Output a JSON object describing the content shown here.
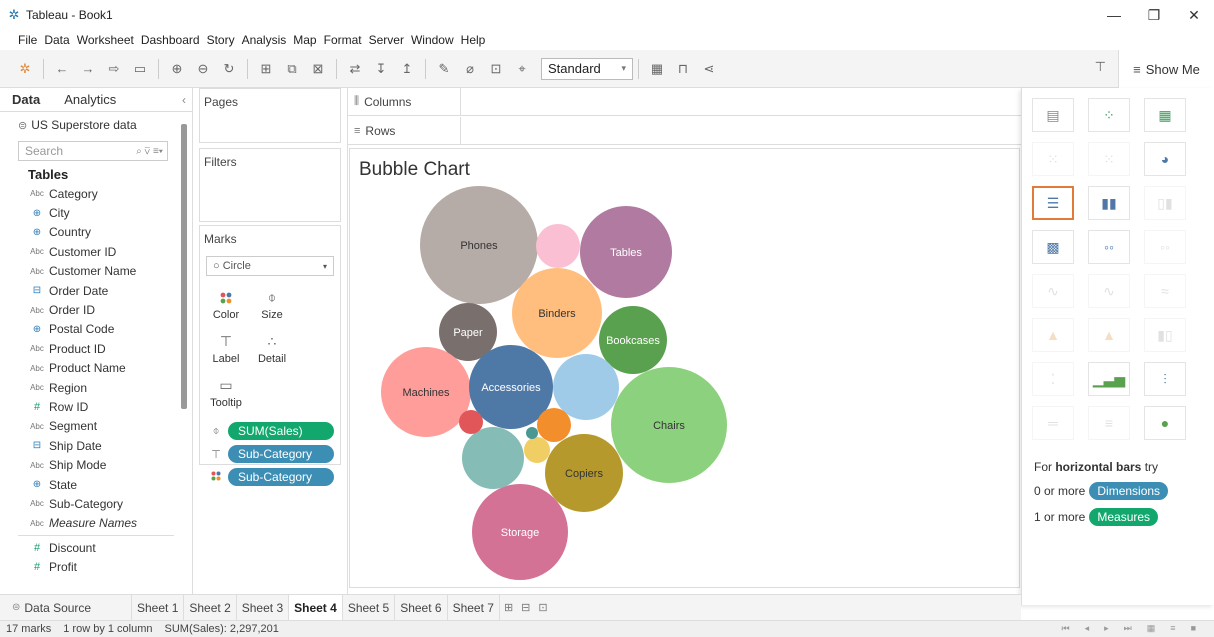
{
  "window": {
    "title": "Tableau - Book1"
  },
  "menu": [
    "File",
    "Data",
    "Worksheet",
    "Dashboard",
    "Story",
    "Analysis",
    "Map",
    "Format",
    "Server",
    "Window",
    "Help"
  ],
  "toolbar": {
    "fit_select": "Standard",
    "show_me": "Show Me"
  },
  "data_pane": {
    "tabs": [
      "Data",
      "Analytics"
    ],
    "datasource": "US Superstore data",
    "search_placeholder": "Search",
    "tables_header": "Tables",
    "fields": [
      {
        "name": "Category",
        "type": "Abc"
      },
      {
        "name": "City",
        "type": "geo"
      },
      {
        "name": "Country",
        "type": "geo"
      },
      {
        "name": "Customer ID",
        "type": "Abc"
      },
      {
        "name": "Customer Name",
        "type": "Abc"
      },
      {
        "name": "Order Date",
        "type": "date"
      },
      {
        "name": "Order ID",
        "type": "Abc"
      },
      {
        "name": "Postal Code",
        "type": "geo"
      },
      {
        "name": "Product ID",
        "type": "Abc"
      },
      {
        "name": "Product Name",
        "type": "Abc"
      },
      {
        "name": "Region",
        "type": "Abc"
      },
      {
        "name": "Row ID",
        "type": "num"
      },
      {
        "name": "Segment",
        "type": "Abc"
      },
      {
        "name": "Ship Date",
        "type": "date"
      },
      {
        "name": "Ship Mode",
        "type": "Abc"
      },
      {
        "name": "State",
        "type": "geo"
      },
      {
        "name": "Sub-Category",
        "type": "Abc"
      },
      {
        "name": "Measure Names",
        "type": "Abc"
      }
    ],
    "measures": [
      {
        "name": "Discount",
        "type": "num"
      },
      {
        "name": "Profit",
        "type": "num"
      }
    ]
  },
  "cards": {
    "pages": "Pages",
    "filters": "Filters",
    "marks": "Marks",
    "mark_type": "Circle",
    "mark_buttons": [
      "Color",
      "Size",
      "Label",
      "Detail",
      "Tooltip"
    ],
    "pills": [
      {
        "icon": "size",
        "label": "SUM(Sales)",
        "kind": "measure"
      },
      {
        "icon": "label",
        "label": "Sub-Category",
        "kind": "dim"
      },
      {
        "icon": "color",
        "label": "Sub-Category",
        "kind": "dim"
      }
    ]
  },
  "shelves": {
    "columns": "Columns",
    "rows": "Rows"
  },
  "viz": {
    "title": "Bubble Chart"
  },
  "chart_data": {
    "type": "bubble",
    "title": "Bubble Chart",
    "size_measure": "SUM(Sales)",
    "label_dimension": "Sub-Category",
    "bubbles": [
      {
        "label": "Phones",
        "color": "#b5aba7",
        "show_label": true,
        "text_color": "#333333"
      },
      {
        "label": "Tables",
        "color": "#b07aa1",
        "show_label": true,
        "text_color": "#ffffff"
      },
      {
        "label": "Binders",
        "color": "#ffbe7d",
        "show_label": true,
        "text_color": "#333333"
      },
      {
        "label": "Bookcases",
        "color": "#59a14f",
        "show_label": true,
        "text_color": "#ffffff"
      },
      {
        "label": "Paper",
        "color": "#79706e",
        "show_label": true,
        "text_color": "#ffffff"
      },
      {
        "label": "Machines",
        "color": "#ff9d9a",
        "show_label": true,
        "text_color": "#333333"
      },
      {
        "label": "Accessories",
        "color": "#4e79a7",
        "show_label": true,
        "text_color": "#ffffff"
      },
      {
        "label": "Chairs",
        "color": "#8cd17d",
        "show_label": true,
        "text_color": "#333333"
      },
      {
        "label": "Copiers",
        "color": "#b6992d",
        "show_label": true,
        "text_color": "#333333"
      },
      {
        "label": "Storage",
        "color": "#d37295",
        "show_label": true,
        "text_color": "#ffffff"
      },
      {
        "label": "",
        "color": "#fabfd2",
        "show_label": false,
        "text_color": "#333333"
      },
      {
        "label": "",
        "color": "#a0cbe8",
        "show_label": false,
        "text_color": "#333333"
      },
      {
        "label": "",
        "color": "#86bcb6",
        "show_label": false,
        "text_color": "#333333"
      },
      {
        "label": "",
        "color": "#f28e2b",
        "show_label": false,
        "text_color": "#333333"
      },
      {
        "label": "",
        "color": "#e15759",
        "show_label": false,
        "text_color": "#333333"
      },
      {
        "label": "",
        "color": "#f1ce63",
        "show_label": false,
        "text_color": "#333333"
      },
      {
        "label": "",
        "color": "#499894",
        "show_label": false,
        "text_color": "#333333"
      }
    ]
  },
  "show_me": {
    "hint_prefix": "For ",
    "hint_bold": "horizontal bars",
    "hint_suffix": " try",
    "dim_prefix": "0 or more",
    "dim_pill": "Dimensions",
    "mea_prefix": "1 or more",
    "mea_pill": "Measures"
  },
  "sheets": {
    "data_source": "Data Source",
    "tabs": [
      "Sheet 1",
      "Sheet 2",
      "Sheet 3",
      "Sheet 4",
      "Sheet 5",
      "Sheet 6",
      "Sheet 7"
    ],
    "active": "Sheet 4"
  },
  "status": {
    "marks": "17 marks",
    "grid": "1 row by 1 column",
    "sum": "SUM(Sales): 2,297,201"
  }
}
